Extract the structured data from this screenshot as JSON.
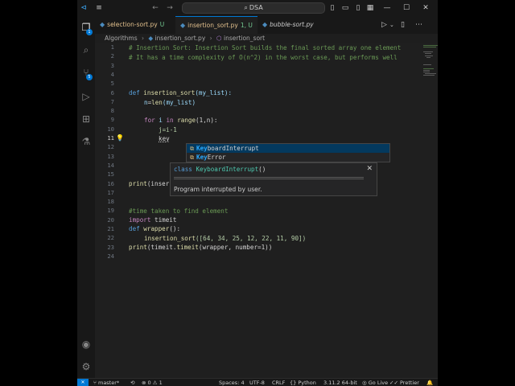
{
  "titlebar": {
    "search_label": "DSA",
    "icons": [
      "vscode-logo",
      "menu-icon",
      "back-arrow-icon",
      "forward-arrow-icon",
      "layout-sidebar-icon",
      "layout-panel-icon",
      "layout-secondary-icon",
      "layout-customize-icon",
      "minimize-icon",
      "maximize-icon",
      "close-icon"
    ]
  },
  "activity": {
    "explorer_badge": "1",
    "scm_badge": "5"
  },
  "tabs": [
    {
      "label": "selection-sort.py",
      "badge": "U"
    },
    {
      "label": "insertion_sort.py",
      "badge": "1, U"
    },
    {
      "label": "bubble-sort.py",
      "badge": ""
    }
  ],
  "breadcrumb": {
    "folder": "Algorithms",
    "file": "insertion_sort.py",
    "symbol": "insertion_sort"
  },
  "editor": {
    "line_numbers": [
      "1",
      "2",
      "3",
      "4",
      "5",
      "6",
      "7",
      "8",
      "9",
      "10",
      "11",
      "12",
      "13",
      "14",
      "15",
      "16",
      "17",
      "18",
      "19",
      "20",
      "21",
      "22",
      "23",
      "24"
    ],
    "current_line": "11",
    "code": {
      "l1": "# Insertion Sort: Insertion Sort builds the final sorted array one element",
      "l2": "# It has a time complexity of O(n^2) in the worst case, but performs well",
      "l6_def": "def",
      "l6_fn": "insertion_sort",
      "l6_rest": "(my_list):",
      "l7_var": "n",
      "l7_eq": "=",
      "l7_fn": "len",
      "l7_rest": "(my_list)",
      "l9_for": "for",
      "l9_i": "i",
      "l9_in": "in",
      "l9_fn": "range",
      "l9_rest": "(1,n):",
      "l10": "j=i-1",
      "l11": "key",
      "l16_fn": "print",
      "l16_rest": "(inser",
      "l19": "#time taken to find element",
      "l20_kw": "import",
      "l20_rest": "timeit",
      "l21_def": "def",
      "l21_fn": "wrapper",
      "l21_rest": "():",
      "l22_fn": "insertion_sort",
      "l22_rest": "([64, 34, 25, 12, 22, 11, 90])",
      "l23_fn": "print",
      "l23_mid": "(timeit.",
      "l23_fn2": "timeit",
      "l23_rest": "(wrapper, number=1))"
    }
  },
  "suggest": {
    "items": [
      {
        "match": "Key",
        "rest": "boardInterrupt"
      },
      {
        "match": "Key",
        "rest": "Error"
      }
    ]
  },
  "details": {
    "signature_kw": "class",
    "signature_name": "KeyboardInterrupt",
    "signature_rest": "()",
    "doc": "Program interrupted by user."
  },
  "statusbar": {
    "branch": "master*",
    "errors": "0",
    "warnings": "1",
    "spaces": "Spaces: 4",
    "encoding": "UTF-8",
    "eol": "CRLF",
    "language": "Python",
    "interpreter": "3.11.2 64-bit",
    "golive": "Go Live",
    "prettier": "Prettier"
  }
}
